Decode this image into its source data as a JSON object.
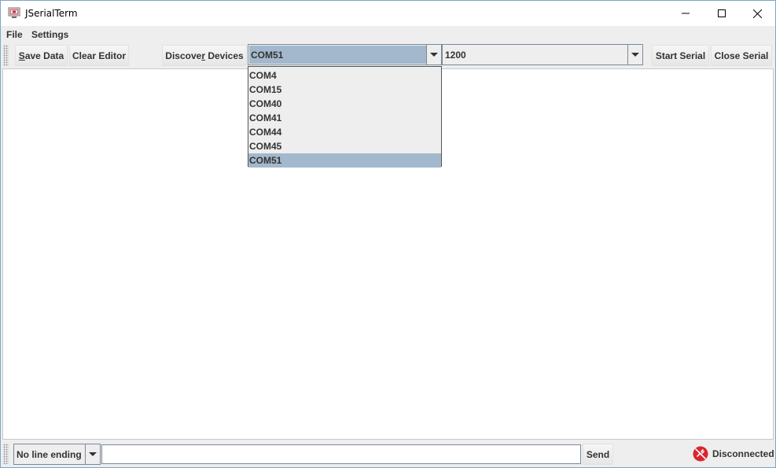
{
  "window": {
    "title": "JSerialTerm",
    "minimize_icon": "minimize-icon",
    "maximize_icon": "maximize-icon",
    "close_icon": "close-icon"
  },
  "menu": {
    "items": [
      {
        "label": "File"
      },
      {
        "label": "Settings"
      }
    ]
  },
  "toolbar": {
    "save_data_label": {
      "pre": "",
      "mnemonic": "S",
      "post": "ave Data"
    },
    "clear_editor_label": "Clear Editor",
    "discover_devices_label": {
      "pre": "Discove",
      "mnemonic": "r",
      "post": " Devices"
    },
    "port_selected": "COM51",
    "baud_selected": "1200",
    "start_serial_label": "Start Serial",
    "close_serial_label": "Close Serial"
  },
  "port_dropdown": {
    "options": [
      "COM4",
      "COM15",
      "COM40",
      "COM41",
      "COM44",
      "COM45",
      "COM51"
    ],
    "selected": "COM51"
  },
  "bottombar": {
    "line_ending_selected": "No line ending",
    "message_value": "",
    "send_label": "Send",
    "status_text": "Disconnected",
    "status_icon": "disconnected-icon"
  },
  "colors": {
    "selection": "#a3b8cc",
    "status_icon_red": "#d9262c",
    "window_border": "#7aa7c7"
  }
}
